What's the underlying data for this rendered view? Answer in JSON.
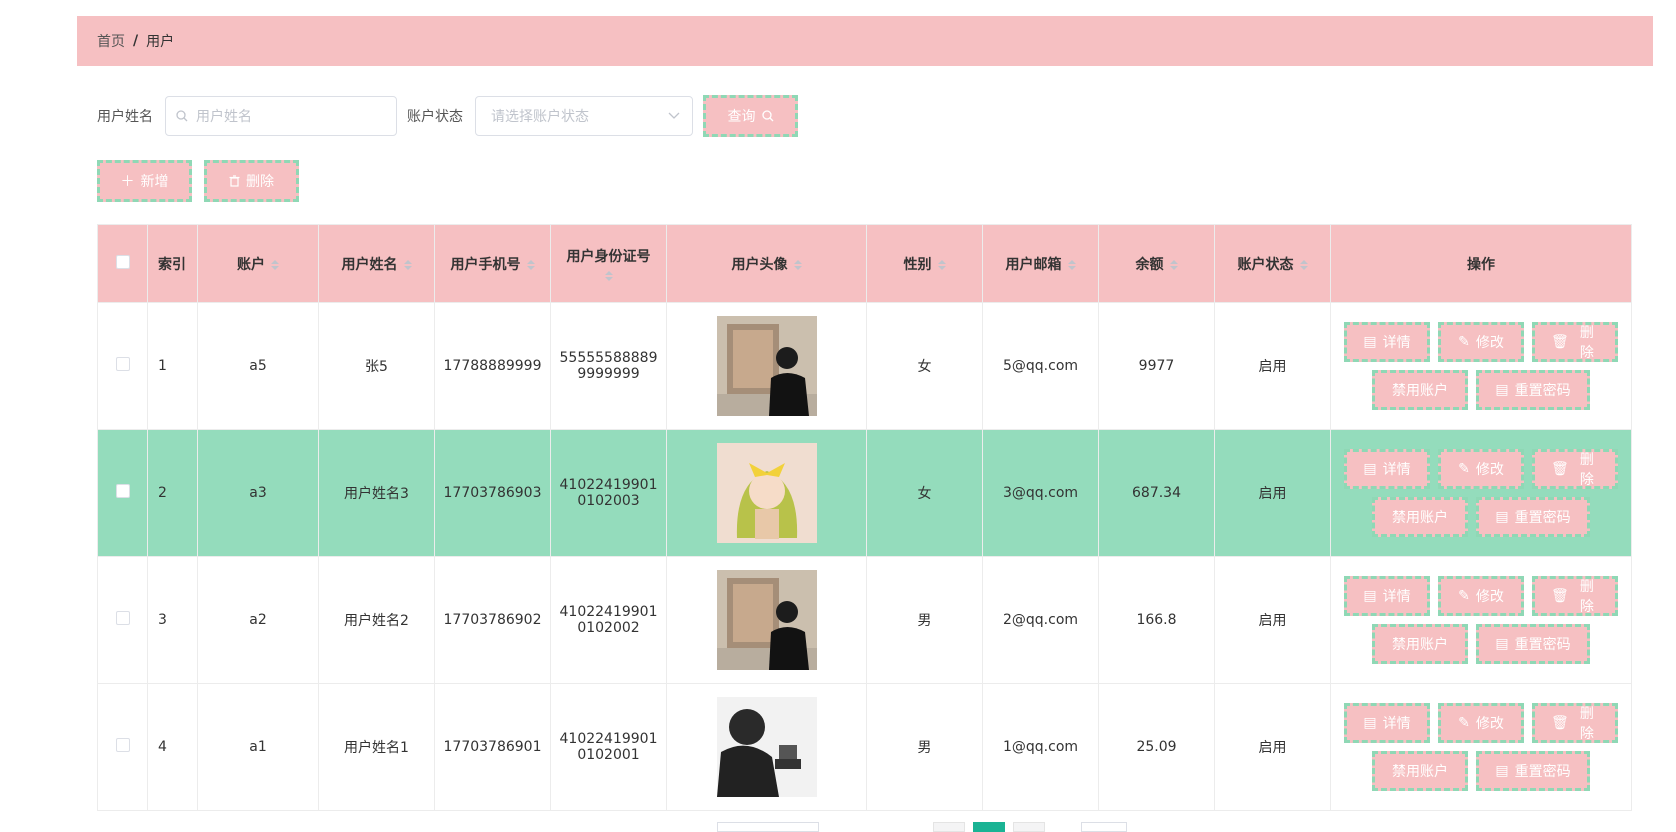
{
  "breadcrumb": {
    "home": "首页",
    "separator": "/",
    "current": "用户"
  },
  "search": {
    "name_label": "用户姓名",
    "name_placeholder": "用户姓名",
    "status_label": "账户状态",
    "status_placeholder": "请选择账户状态",
    "query_label": "查询"
  },
  "toolbar": {
    "add_label": "新增",
    "delete_label": "删除"
  },
  "table": {
    "headers": {
      "index": "索引",
      "account": "账户",
      "name": "用户姓名",
      "phone": "用户手机号",
      "idcard": "用户身份证号",
      "avatar": "用户头像",
      "gender": "性别",
      "email": "用户邮箱",
      "balance": "余额",
      "status": "账户状态",
      "ops": "操作"
    },
    "rows": [
      {
        "index": "1",
        "account": "a5",
        "name": "张5",
        "phone": "17788889999",
        "idcard_1": "55555588889",
        "idcard_2": "9999999",
        "avatar": "person-photo",
        "gender": "女",
        "email": "5@qq.com",
        "balance": "9977",
        "status": "启用"
      },
      {
        "index": "2",
        "account": "a3",
        "name": "用户姓名3",
        "phone": "17703786903",
        "idcard_1": "41022419901",
        "idcard_2": "0102003",
        "avatar": "anime-girl",
        "gender": "女",
        "email": "3@qq.com",
        "balance": "687.34",
        "status": "启用"
      },
      {
        "index": "3",
        "account": "a2",
        "name": "用户姓名2",
        "phone": "17703786902",
        "idcard_1": "41022419901",
        "idcard_2": "0102002",
        "avatar": "person-photo",
        "gender": "男",
        "email": "2@qq.com",
        "balance": "166.8",
        "status": "启用"
      },
      {
        "index": "4",
        "account": "a1",
        "name": "用户姓名1",
        "phone": "17703786901",
        "idcard_1": "41022419901",
        "idcard_2": "0102001",
        "avatar": "man-bw-photo",
        "gender": "男",
        "email": "1@qq.com",
        "balance": "25.09",
        "status": "启用"
      }
    ],
    "ops": {
      "detail": "详情",
      "edit": "修改",
      "delete": "删除",
      "disable": "禁用账户",
      "reset": "重置密码"
    }
  },
  "colors": {
    "header_bg": "#f6c0c2",
    "highlight_row": "#94dcbc",
    "button_border": "#8fd8b5",
    "page_active": "#1ab394"
  }
}
